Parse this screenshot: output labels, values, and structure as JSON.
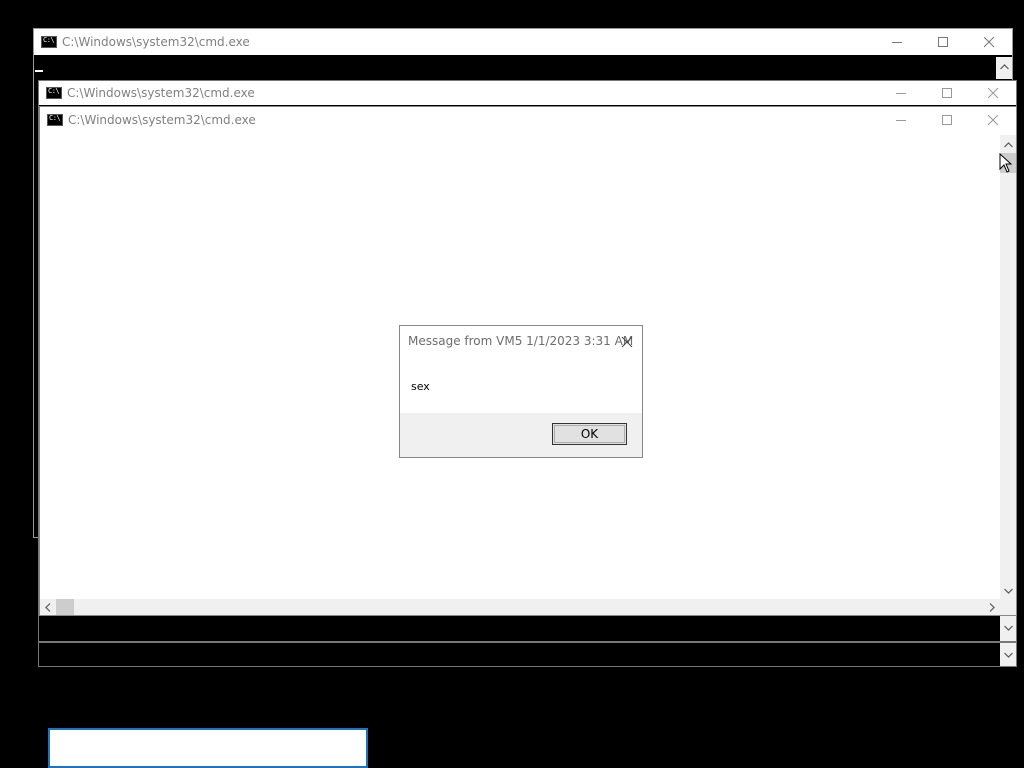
{
  "windows": [
    {
      "title": "C:\\Windows\\system32\\cmd.exe"
    },
    {
      "title": "C:\\Windows\\system32\\cmd.exe"
    },
    {
      "title": "C:\\Windows\\system32\\cmd.exe"
    }
  ],
  "dialog": {
    "title": "Message from VM5 1/1/2023 3:31 AM",
    "message": "sex",
    "ok_label": "OK"
  },
  "input": {
    "value": ""
  },
  "colors": {
    "desktop": "#000000",
    "titlebar": "#ffffff",
    "title_text": "#808080",
    "focus_border": "#1e73be"
  },
  "icons": [
    "cmd-icon",
    "minimize-icon",
    "maximize-icon",
    "close-icon",
    "scroll-up-arrow-icon",
    "scroll-down-arrow-icon",
    "scroll-left-arrow-icon",
    "scroll-right-arrow-icon",
    "mouse-cursor-icon"
  ]
}
